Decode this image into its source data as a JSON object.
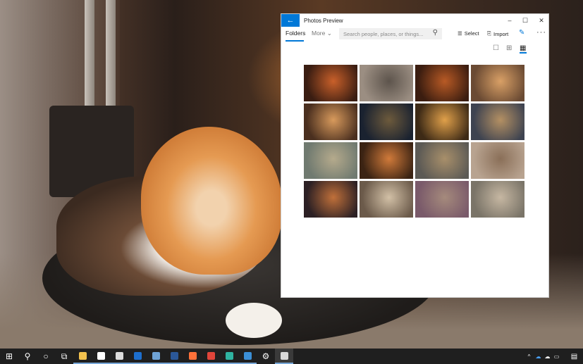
{
  "window": {
    "title": "Photos Preview",
    "controls": {
      "minimize": "–",
      "maximize": "☐",
      "close": "✕"
    }
  },
  "nav": {
    "folders": "Folders",
    "more": "More ⌄",
    "search_placeholder": "Search people, places, or things..."
  },
  "toolbar": {
    "select_label": "Select",
    "import_label": "Import",
    "more": "···"
  },
  "icons": {
    "back": "←",
    "search": "⚲",
    "select": "☰",
    "import": "⎘",
    "pen": "✎",
    "view_single": "☐",
    "view_medium": "⊞",
    "view_large": "▦"
  },
  "gallery": {
    "rows": [
      [
        {
          "a": "#3a1d12",
          "b": "#c9602a"
        },
        {
          "a": "#9b8e82",
          "b": "#5d544c"
        },
        {
          "a": "#3b1d10",
          "b": "#b85a25"
        },
        {
          "a": "#6a4a33",
          "b": "#d9a066"
        }
      ],
      [
        {
          "a": "#4a2f1f",
          "b": "#d89a5c"
        },
        {
          "a": "#1a2230",
          "b": "#6d5a3c"
        },
        {
          "a": "#3d2a16",
          "b": "#e0a04a"
        },
        {
          "a": "#3e4350",
          "b": "#b49063"
        }
      ],
      [
        {
          "a": "#707a70",
          "b": "#b5aa8c"
        },
        {
          "a": "#3b2313",
          "b": "#d07a3a"
        },
        {
          "a": "#5c5a55",
          "b": "#a88f6a"
        },
        {
          "a": "#b8a390",
          "b": "#8a6f58"
        }
      ],
      [
        {
          "a": "#2c2024",
          "b": "#c0703a"
        },
        {
          "a": "#6b5a4a",
          "b": "#d2c0a6"
        },
        {
          "a": "#7a5a6a",
          "b": "#a58a7c"
        },
        {
          "a": "#7a7468",
          "b": "#c6b7a2"
        }
      ]
    ]
  },
  "taskbar": {
    "start_icon": "⊞",
    "search_icon": "⚲",
    "cortana_icon": "○",
    "taskview_icon": "⧉",
    "settings_icon": "⚙",
    "tray": {
      "chevron": "^",
      "notification": "▤"
    },
    "apps": [
      {
        "name": "file-explorer",
        "color": "#f2c14e"
      },
      {
        "name": "store",
        "color": "#ffffff"
      },
      {
        "name": "mail",
        "color": "#dcdcdc"
      },
      {
        "name": "outlook",
        "color": "#1d6fce"
      },
      {
        "name": "photos-legacy",
        "color": "#6fa3d6"
      },
      {
        "name": "word",
        "color": "#2b5797"
      },
      {
        "name": "firefox",
        "color": "#ff7139"
      },
      {
        "name": "chrome",
        "color": "#e0453a"
      },
      {
        "name": "edge",
        "color": "#2fb3a1"
      },
      {
        "name": "edge-beta",
        "color": "#3b8fd6"
      }
    ]
  }
}
